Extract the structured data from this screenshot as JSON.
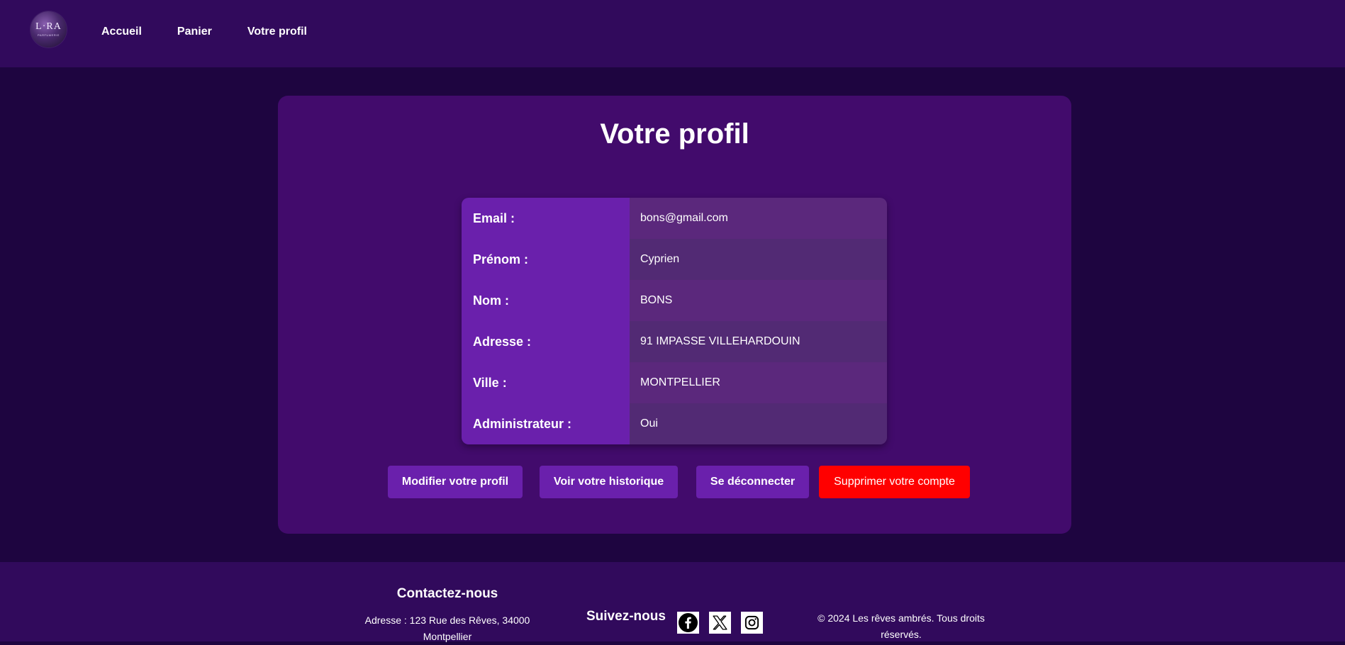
{
  "header": {
    "logo_text": "L·RA",
    "logo_subtext": "PARFUMERIE",
    "nav": [
      {
        "label": "Accueil"
      },
      {
        "label": "Panier"
      },
      {
        "label": "Votre profil"
      }
    ]
  },
  "main": {
    "title": "Votre profil",
    "profile": [
      {
        "label": "Email :",
        "value": "bons@gmail.com"
      },
      {
        "label": "Prénom :",
        "value": "Cyprien"
      },
      {
        "label": "Nom :",
        "value": "BONS"
      },
      {
        "label": "Adresse :",
        "value": "91 IMPASSE VILLEHARDOUIN"
      },
      {
        "label": "Ville :",
        "value": "MONTPELLIER"
      },
      {
        "label": "Administrateur :",
        "value": "Oui"
      }
    ],
    "buttons": {
      "edit": "Modifier votre profil",
      "history": "Voir votre historique",
      "logout": "Se déconnecter",
      "delete": "Supprimer votre compte"
    }
  },
  "footer": {
    "contact_title": "Contactez-nous",
    "contact_address": "Adresse : 123 Rue des Rêves, 34000 Montpellier",
    "follow_label": "Suivez-nous",
    "social": [
      {
        "name": "facebook-icon"
      },
      {
        "name": "x-twitter-icon"
      },
      {
        "name": "instagram-icon"
      }
    ],
    "copyright": "© 2024 Les rêves ambrés. Tous droits réservés."
  },
  "colors": {
    "background": "#1e0540",
    "header_footer": "#310a5c",
    "card": "#420b6c",
    "label_cell": "#6a20ac",
    "button_primary": "#6a20ac",
    "button_danger": "#ff0000"
  }
}
